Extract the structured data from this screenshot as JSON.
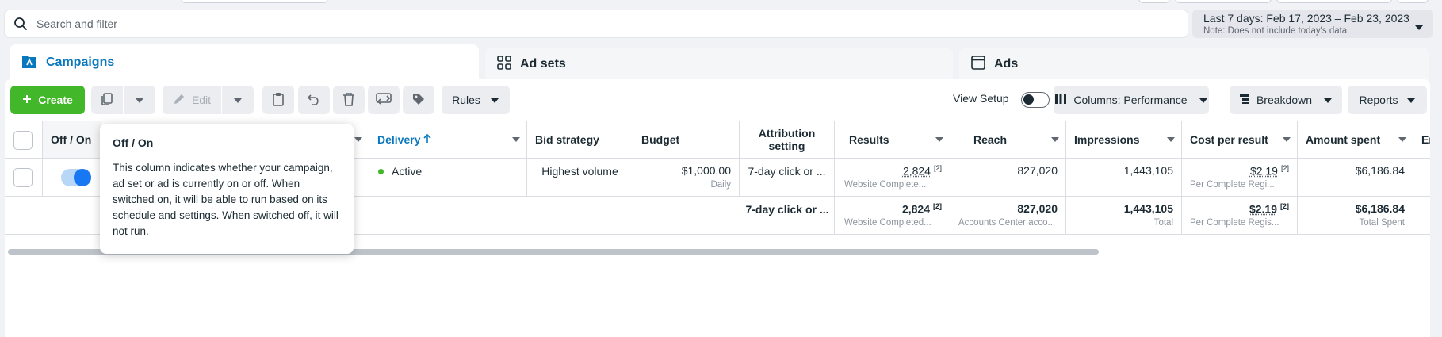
{
  "search": {
    "placeholder": "Search and filter"
  },
  "date_range": {
    "label": "Last 7 days: Feb 17, 2023 – Feb 23, 2023",
    "note": "Note: Does not include today's data"
  },
  "tabs": [
    {
      "label": "Campaigns",
      "icon": "campaign-icon",
      "active": true
    },
    {
      "label": "Ad sets",
      "icon": "grid-icon",
      "active": false
    },
    {
      "label": "Ads",
      "icon": "window-icon",
      "active": false
    }
  ],
  "toolbar": {
    "create_label": "Create",
    "edit_label": "Edit",
    "rules_label": "Rules",
    "view_setup_label": "View Setup",
    "view_setup_on": false,
    "columns_label": "Columns: Performance",
    "breakdown_label": "Breakdown",
    "reports_label": "Reports"
  },
  "table": {
    "columns": {
      "off_on": "Off / On",
      "delivery": "Delivery",
      "bid_strategy": "Bid strategy",
      "budget": "Budget",
      "attribution": "Attribution setting",
      "results": "Results",
      "reach": "Reach",
      "impressions": "Impressions",
      "cost_per_result": "Cost per result",
      "amount_spent": "Amount spent",
      "ends": "End"
    },
    "row": {
      "on": true,
      "delivery": "Active",
      "bid_strategy": "Highest volume",
      "budget": "$1,000.00",
      "budget_sub": "Daily",
      "attribution": "7-day click or ...",
      "results": "2,824",
      "results_sup": "[2]",
      "results_sub": "Website Complete...",
      "reach": "827,020",
      "impressions": "1,443,105",
      "cost_per_result": "$2.19",
      "cost_sup": "[2]",
      "cost_sub": "Per Complete Regi...",
      "amount_spent": "$6,186.84"
    },
    "summary": {
      "attribution": "7-day click or ...",
      "results": "2,824",
      "results_sup": "[2]",
      "results_sub": "Website Completed...",
      "reach": "827,020",
      "reach_sub": "Accounts Center acco...",
      "impressions": "1,443,105",
      "impressions_sub": "Total",
      "cost_per_result": "$2.19",
      "cost_sup": "[2]",
      "cost_sub": "Per Complete Regis...",
      "amount_spent": "$6,186.84",
      "amount_sub": "Total Spent"
    }
  },
  "tooltip": {
    "title": "Off / On",
    "body": "This column indicates whether your campaign, ad set or ad is currently on or off. When switched on, it will be able to run based on its schedule and settings. When switched off, it will not run."
  },
  "colors": {
    "accent": "#0a78be",
    "create": "#42b72a",
    "toggle": "#1877f2",
    "active_dot": "#42b72a"
  }
}
